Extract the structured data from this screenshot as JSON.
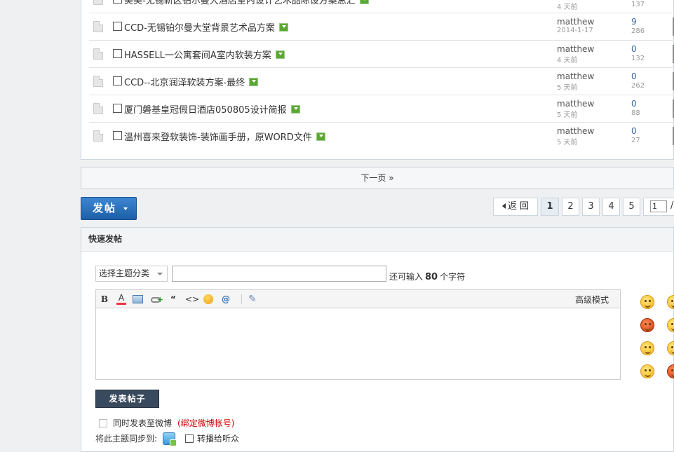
{
  "threads": [
    {
      "title": "美美-无锡新区铂尔曼大酒店室内设计艺术品陈设方案总汇",
      "author": "",
      "date": "4 天前",
      "replies": "",
      "views": "137"
    },
    {
      "title": "CCD-无锡铂尔曼大堂背景艺术品方案",
      "author": "matthew",
      "date": "2014-1-17",
      "replies": "9",
      "views": "286"
    },
    {
      "title": "HASSELL一公寓套间A室内软装方案",
      "author": "matthew",
      "date": "4 天前",
      "replies": "0",
      "views": "132"
    },
    {
      "title": "CCD--北京润泽软装方案-最终",
      "author": "matthew",
      "date": "5 天前",
      "replies": "0",
      "views": "262"
    },
    {
      "title": "厦门磐基皇冠假日酒店050805设计简报",
      "author": "matthew",
      "date": "5 天前",
      "replies": "0",
      "views": "88"
    },
    {
      "title": "温州喜来登软装饰-装饰画手册，原WORD文件",
      "author": "matthew",
      "date": "5 天前",
      "replies": "0",
      "views": "27"
    }
  ],
  "nav": {
    "next_page": "下一页 »",
    "post_button": "发帖",
    "back": "返 回",
    "pages": [
      "1",
      "2",
      "3",
      "4",
      "5"
    ],
    "page_input": "1",
    "slash": "/"
  },
  "quick_post": {
    "header": "快速发帖",
    "category_select": "选择主题分类",
    "remaining_prefix": "还可输入",
    "remaining_count": "80",
    "remaining_suffix": "个字符",
    "advanced_mode": "高级模式",
    "submit": "发表帖子",
    "weibo_label": "同时发表至微博",
    "weibo_bind": "(绑定微博帐号)",
    "sync_label": "将此主题同步到:",
    "broadcast_label": "转播给听众"
  },
  "toolbar_icons": [
    "bold-icon",
    "font-color-icon",
    "image-icon",
    "link-icon",
    "quote-icon",
    "code-icon",
    "emoticon-icon",
    "mention-icon",
    "attachment-icon"
  ],
  "colors": {
    "accent": "#2a6fb5",
    "post_button": "#1d5fa8",
    "submit_button": "#3a4a5e",
    "bind_red": "#cc0000",
    "page_bg": "#eef0f2"
  }
}
